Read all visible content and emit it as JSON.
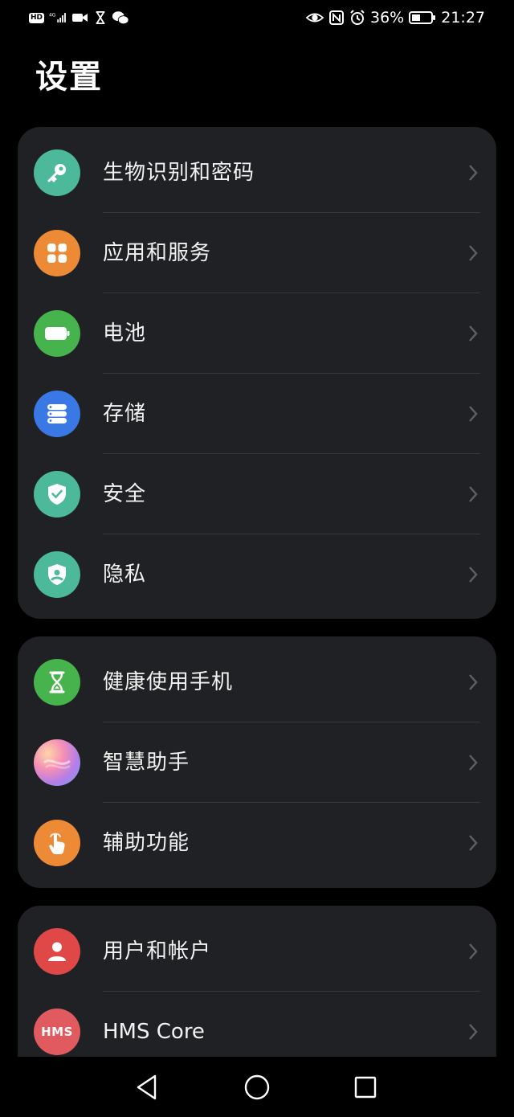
{
  "status_bar": {
    "hd_label": "HD",
    "network": "4G",
    "battery_percent": "36%",
    "time": "21:27"
  },
  "page": {
    "title": "设置"
  },
  "groups": [
    {
      "items": [
        {
          "label": "生物识别和密码",
          "icon": "key-icon",
          "color": "#4cb99a"
        },
        {
          "label": "应用和服务",
          "icon": "apps-grid-icon",
          "color": "#ec8a35"
        },
        {
          "label": "电池",
          "icon": "battery-icon",
          "color": "#47b34c"
        },
        {
          "label": "存储",
          "icon": "storage-icon",
          "color": "#3a78e6"
        },
        {
          "label": "安全",
          "icon": "shield-check-icon",
          "color": "#4cb99a"
        },
        {
          "label": "隐私",
          "icon": "privacy-shield-icon",
          "color": "#4cb99a"
        }
      ]
    },
    {
      "items": [
        {
          "label": "健康使用手机",
          "icon": "hourglass-icon",
          "color": "#47b34c"
        },
        {
          "label": "智慧助手",
          "icon": "assistant-orb-icon",
          "color": "#b47ee8"
        },
        {
          "label": "辅助功能",
          "icon": "hand-tap-icon",
          "color": "#ec8a35"
        }
      ]
    },
    {
      "items": [
        {
          "label": "用户和帐户",
          "icon": "user-icon",
          "color": "#e04848"
        },
        {
          "label": "HMS Core",
          "icon": "hms-logo-icon",
          "color": "#e05a5f",
          "icon_text": "HMS"
        }
      ]
    }
  ]
}
